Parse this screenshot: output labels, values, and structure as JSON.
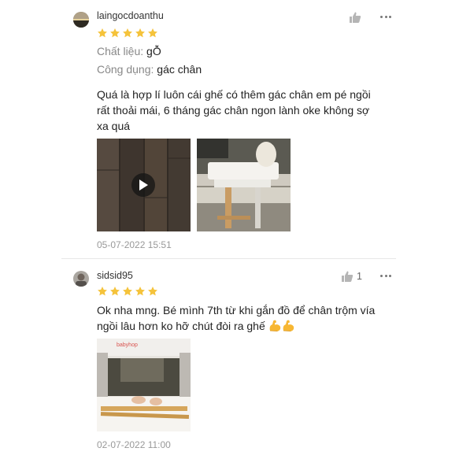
{
  "reviews": [
    {
      "username": "laingocdoanthu",
      "rating": 5,
      "material_label": "Chất liệu:",
      "material_value": "gỖ",
      "usage_label": "Công dụng:",
      "usage_value": "gác chân",
      "text_lines": [
        "Quá là hợp lí luôn cái ghế có thêm gác chân em pé ngồi",
        "rất thoải mái, 6 tháng gác chân ngon lành oke không sợ",
        "xa quá"
      ],
      "date": "05-07-2022 15:51"
    },
    {
      "username": "sidsid95",
      "rating": 5,
      "like_count": "1",
      "text_lines": [
        "Ok nha mng. Bé mình 7th từ khi gắn đồ để chân trộm vía",
        "ngồi lâu hơn ko hỡ chút đòi ra ghế"
      ],
      "photo_brand": "babyhop",
      "date": "02-07-2022 11:00"
    }
  ],
  "colors": {
    "star": "#f5c33b",
    "muted": "#999999",
    "divider": "#e8e8e8"
  },
  "icons": [
    "thumbs-up-icon",
    "more-options-icon",
    "star-icon",
    "play-icon",
    "flexed-biceps-emoji"
  ]
}
